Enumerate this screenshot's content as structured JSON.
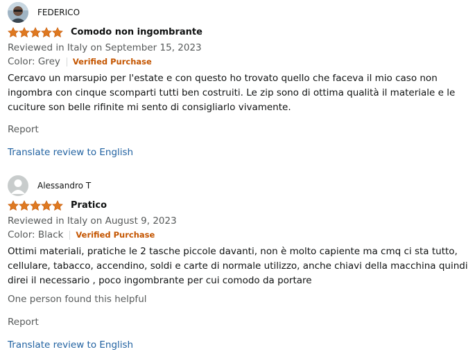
{
  "reviews": [
    {
      "reviewer": "FEDERICO",
      "avatar_icon": "photo-avatar-icon",
      "rating": 5,
      "title": "Comodo non ingombrante",
      "date": "Reviewed in Italy on September 15, 2023",
      "color": "Color: Grey",
      "verified": "Verified Purchase",
      "body": "Cercavo un marsupio per l'estate e con questo ho trovato quello che faceva il mio caso non ingombra con cinque scomparti tutti ben costruiti. Le zip sono di ottima qualità il materiale e le cuciture son belle rifinite mi sento di consigliarlo vivamente.",
      "report": "Report",
      "translate": "Translate review to English"
    },
    {
      "reviewer": "Alessandro T",
      "avatar_icon": "default-user-icon",
      "rating": 5,
      "title": "Pratico",
      "date": "Reviewed in Italy on August 9, 2023",
      "color": "Color: Black",
      "verified": "Verified Purchase",
      "body": "Ottimi materiali, pratiche le 2 tasche piccole davanti, non è molto capiente ma cmq ci sta tutto, cellulare, tabacco, accendino, soldi e carte di normale utilizzo, anche chiavi della macchina quindi direi il necessario , poco ingombrante per cui comodo da portare",
      "helpful": "One person found this helpful",
      "report": "Report",
      "translate": "Translate review to English"
    }
  ],
  "colors": {
    "star": "#de7921",
    "link": "#2162a1",
    "verified": "#c45500",
    "secondary_text": "#565959"
  }
}
